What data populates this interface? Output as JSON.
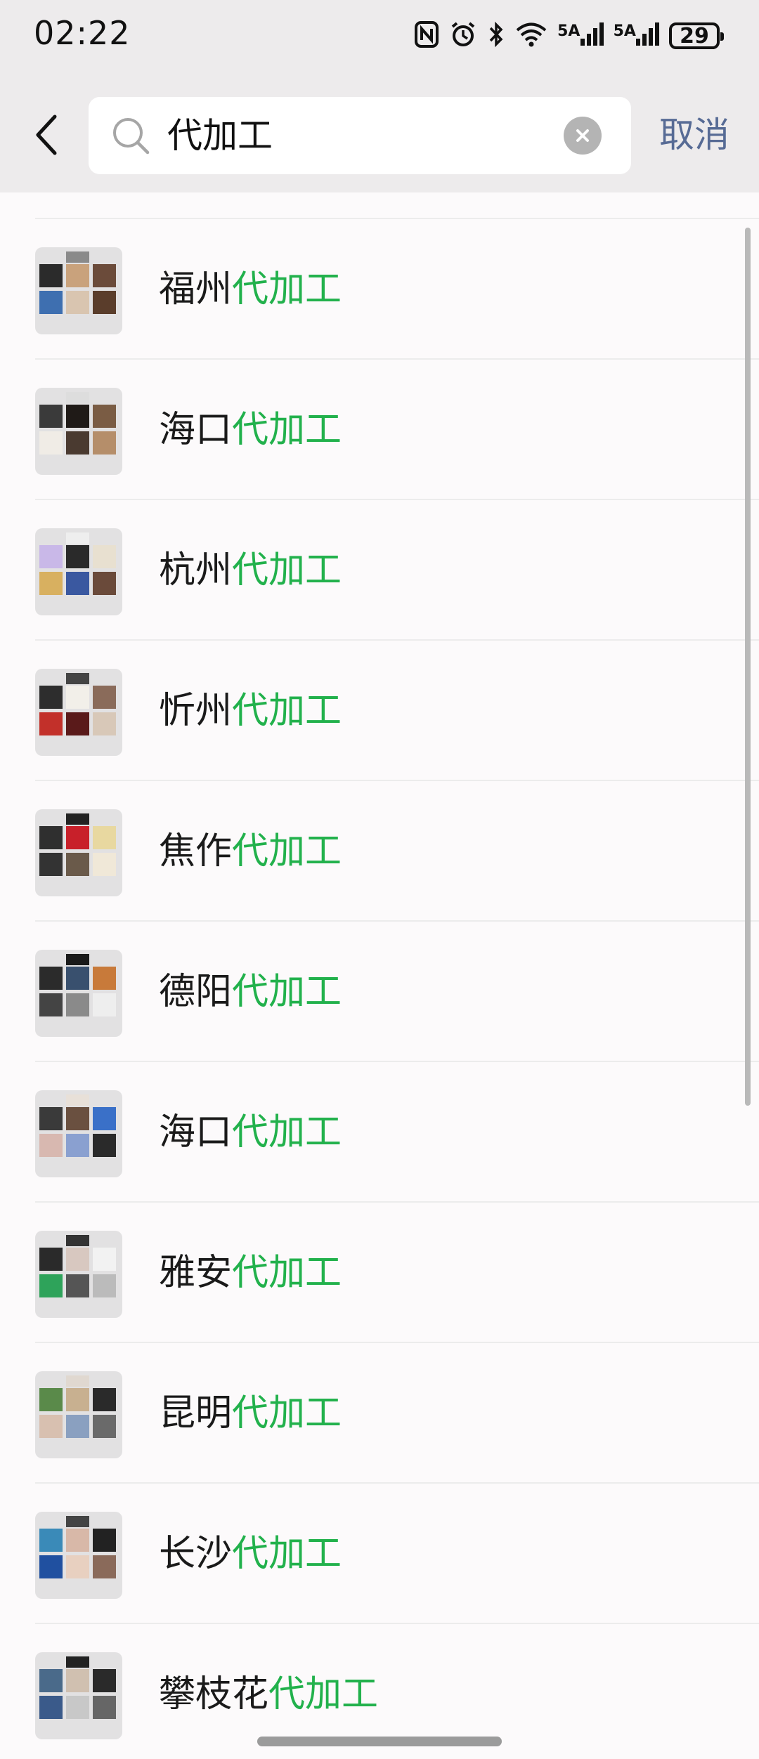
{
  "status_bar": {
    "time": "02:22",
    "signal1_label": "5A",
    "signal2_label": "5A",
    "battery": "29",
    "icons": [
      "nfc-icon",
      "alarm-icon",
      "bluetooth-icon",
      "wifi-icon",
      "signal-icon",
      "signal-icon",
      "battery-icon"
    ]
  },
  "search": {
    "query": "代加工",
    "cancel_label": "取消",
    "icons": [
      "back-arrow-icon",
      "search-icon",
      "clear-icon"
    ]
  },
  "colors": {
    "highlight": "#22b14c",
    "cancel": "#576b95",
    "header_bg": "#edebec"
  },
  "results": [
    {
      "prefix": "福州",
      "highlight": "代加工"
    },
    {
      "prefix": "海口",
      "highlight": "代加工"
    },
    {
      "prefix": "杭州",
      "highlight": "代加工"
    },
    {
      "prefix": "忻州",
      "highlight": "代加工"
    },
    {
      "prefix": "焦作",
      "highlight": "代加工"
    },
    {
      "prefix": "德阳",
      "highlight": "代加工"
    },
    {
      "prefix": "海口",
      "highlight": "代加工"
    },
    {
      "prefix": "雅安",
      "highlight": "代加工"
    },
    {
      "prefix": "昆明",
      "highlight": "代加工"
    },
    {
      "prefix": "长沙",
      "highlight": "代加工"
    },
    {
      "prefix": "攀枝花",
      "highlight": "代加工"
    }
  ]
}
